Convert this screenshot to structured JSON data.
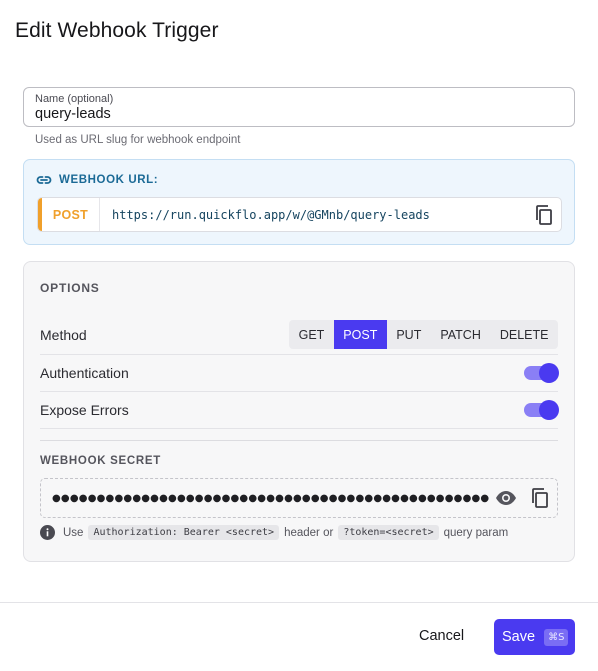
{
  "dialog": {
    "title": "Edit Webhook Trigger"
  },
  "name_field": {
    "label": "Name (optional)",
    "value": "query-leads",
    "helper": "Used as URL slug for webhook endpoint"
  },
  "webhook_url": {
    "heading": "WEBHOOK URL:",
    "method": "POST",
    "url": "https://run.quickflo.app/w/@GMnb/query-leads",
    "method_color": "#f0a02b"
  },
  "options": {
    "title": "OPTIONS",
    "method_label": "Method",
    "methods": [
      "GET",
      "POST",
      "PUT",
      "PATCH",
      "DELETE"
    ],
    "selected_method": "POST",
    "authentication_label": "Authentication",
    "authentication_on": true,
    "expose_errors_label": "Expose Errors",
    "expose_errors_on": true
  },
  "secret": {
    "title": "WEBHOOK SECRET",
    "masked": "●●●●●●●●●●●●●●●●●●●●●●●●●●●●●●●●●●●●●●●●●●●●●●●●●●●●●●●●●●●●●●●●●●●●●●●●●●●●",
    "note_use": "Use",
    "note_header_code": "Authorization: Bearer <secret>",
    "note_or": "header or",
    "note_token_code": "?token=<secret>",
    "note_suffix": "query param"
  },
  "footer": {
    "cancel_label": "Cancel",
    "save_label": "Save",
    "save_shortcut": "⌘S"
  },
  "colors": {
    "accent": "#4a3af0",
    "url_bg": "#eef6fd",
    "url_accent": "#1b6a96"
  }
}
